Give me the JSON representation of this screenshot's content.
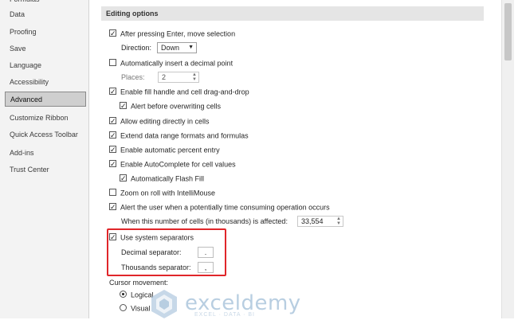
{
  "sidebar": {
    "items": [
      {
        "label": "Formulas"
      },
      {
        "label": "Data"
      },
      {
        "label": "Proofing"
      },
      {
        "label": "Save"
      },
      {
        "label": "Language"
      },
      {
        "label": "Accessibility"
      },
      {
        "label": "Advanced",
        "selected": true
      },
      {
        "label": "Customize Ribbon"
      },
      {
        "label": "Quick Access Toolbar"
      },
      {
        "label": "Add-ins"
      },
      {
        "label": "Trust Center"
      }
    ]
  },
  "editing": {
    "header": "Editing options",
    "move_after_enter": {
      "label": "After pressing Enter, move selection",
      "checked": true
    },
    "direction": {
      "label": "Direction:",
      "value": "Down"
    },
    "auto_decimal": {
      "label": "Automatically insert a decimal point",
      "checked": false
    },
    "places": {
      "label": "Places:",
      "value": "2"
    },
    "fill_handle": {
      "label": "Enable fill handle and cell drag-and-drop",
      "checked": true
    },
    "alert_overwrite": {
      "label": "Alert before overwriting cells",
      "checked": true
    },
    "edit_in_cells": {
      "label": "Allow editing directly in cells",
      "checked": true
    },
    "extend_range": {
      "label": "Extend data range formats and formulas",
      "checked": true
    },
    "auto_percent": {
      "label": "Enable automatic percent entry",
      "checked": true
    },
    "autocomplete": {
      "label": "Enable AutoComplete for cell values",
      "checked": true
    },
    "flash_fill": {
      "label": "Automatically Flash Fill",
      "checked": true
    },
    "zoom_roll": {
      "label": "Zoom on roll with IntelliMouse",
      "checked": false
    },
    "alert_time": {
      "label": "Alert the user when a potentially time consuming operation occurs",
      "checked": true
    },
    "cells_affected": {
      "label": "When this number of cells (in thousands) is affected:",
      "value": "33,554"
    },
    "system_separators": {
      "label": "Use system separators",
      "checked": true
    },
    "decimal_sep": {
      "label": "Decimal separator:",
      "value": "."
    },
    "thousands_sep": {
      "label": "Thousands separator:",
      "value": ","
    },
    "cursor_movement": {
      "label": "Cursor movement:"
    },
    "logical": {
      "label": "Logical",
      "selected": true
    },
    "visual": {
      "label": "Visual",
      "selected": false
    }
  },
  "watermark": {
    "brand": "exceldemy",
    "tagline": "EXCEL · DATA · BI"
  },
  "glyphs": {
    "check": "✓",
    "down": "▼",
    "up": "▲"
  },
  "colors": {
    "highlight": "#e0262a",
    "accent_watermark": "#7fa7c9"
  }
}
